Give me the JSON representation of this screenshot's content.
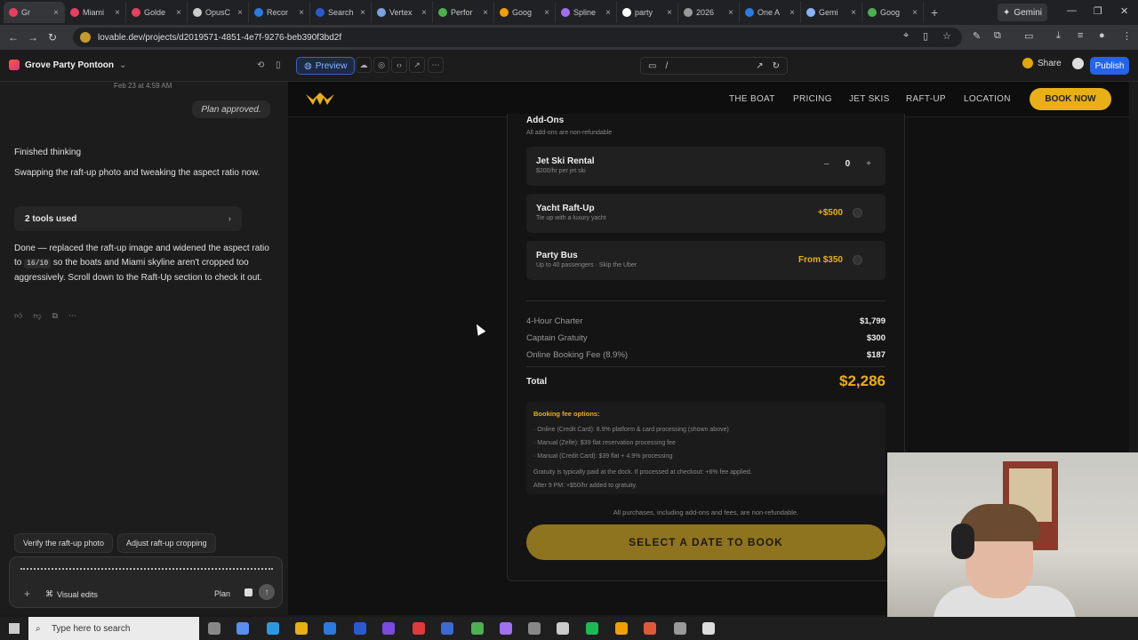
{
  "browser": {
    "tabs": [
      "Gr",
      "Miami",
      "Golde",
      "OpusC",
      "Recor",
      "Search",
      "Vertex",
      "Perfor",
      "Goog",
      "Spline",
      "party",
      "2026",
      "One A",
      "Gemi",
      "Goog"
    ],
    "tab_colors": [
      "#e5405e",
      "#e5405e",
      "#e5405e",
      "#cccccc",
      "#2a7ae2",
      "#2a5ad2",
      "#7aa0e0",
      "#4caf50",
      "#f0a000",
      "#a070f0",
      "#ffffff",
      "#999999",
      "#2a7ae2",
      "#8ab4f8",
      "#4caf50"
    ],
    "gemini_tab": "Gemini",
    "url": "lovable.dev/projects/d2019571-4851-4e7f-9276-beb390f3bd2f"
  },
  "lovable": {
    "project_name": "Grove Party Pontoon",
    "preview_label": "Preview",
    "route": "/",
    "share_label": "Share",
    "publish_label": "Publish"
  },
  "chat": {
    "timestamp": "Feb 23 at 4:59 AM",
    "plan_approved": "Plan approved.",
    "finished_thinking": "Finished thinking",
    "swapping_msg": "Swapping the raft-up photo and tweaking the aspect ratio now.",
    "tools_used": "2 tools used",
    "done_msg_1": "Done — replaced the raft-up image and widened the aspect ratio to",
    "done_code": "16/10",
    "done_msg_2": "so the boats and Miami skyline aren't cropped too aggressively. Scroll down to the Raft-Up section to check it out.",
    "suggestions": [
      "Verify the raft-up photo",
      "Adjust raft-up cropping"
    ],
    "visual_edits": "Visual edits",
    "plan": "Plan"
  },
  "site": {
    "nav": [
      "THE BOAT",
      "PRICING",
      "JET SKIS",
      "RAFT-UP",
      "LOCATION"
    ],
    "book_now": "BOOK NOW",
    "addons_title": "Add-Ons",
    "addons_sub": "All add-ons are non-refundable",
    "addons": [
      {
        "name": "Jet Ski Rental",
        "sub": "$200/hr per jet ski",
        "qty": "0",
        "minus": "–",
        "plus": "+"
      },
      {
        "name": "Yacht Raft-Up",
        "sub": "Tie up with a luxury yacht",
        "price": "+$500"
      },
      {
        "name": "Party Bus",
        "sub": "Up to 40 passengers · Skip the Uber",
        "price": "From $350"
      }
    ],
    "lines": [
      {
        "label": "4-Hour Charter",
        "amount": "$1,799"
      },
      {
        "label": "Captain Gratuity",
        "amount": "$300"
      },
      {
        "label": "Online Booking Fee (8.9%)",
        "amount": "$187"
      }
    ],
    "total_label": "Total",
    "total_amount": "$2,286",
    "fee_title": "Booking fee options:",
    "fee_lines": [
      "· Online (Credit Card): 8.9% platform & card processing (shown above)",
      "· Manual (Zelle): $39 flat reservation processing fee",
      "· Manual (Credit Card): $39 flat + 4.9% processing"
    ],
    "gratuity_lines": [
      "Gratuity is typically paid at the dock. If processed at checkout: +6% fee applied.",
      "After 9 PM: +$50/hr added to gratuity."
    ],
    "nonrefundable": "All purchases, including add-ons and fees, are non-refundable.",
    "select_date": "SELECT A DATE TO BOOK"
  },
  "taskbar": {
    "search_placeholder": "Type here to search"
  }
}
